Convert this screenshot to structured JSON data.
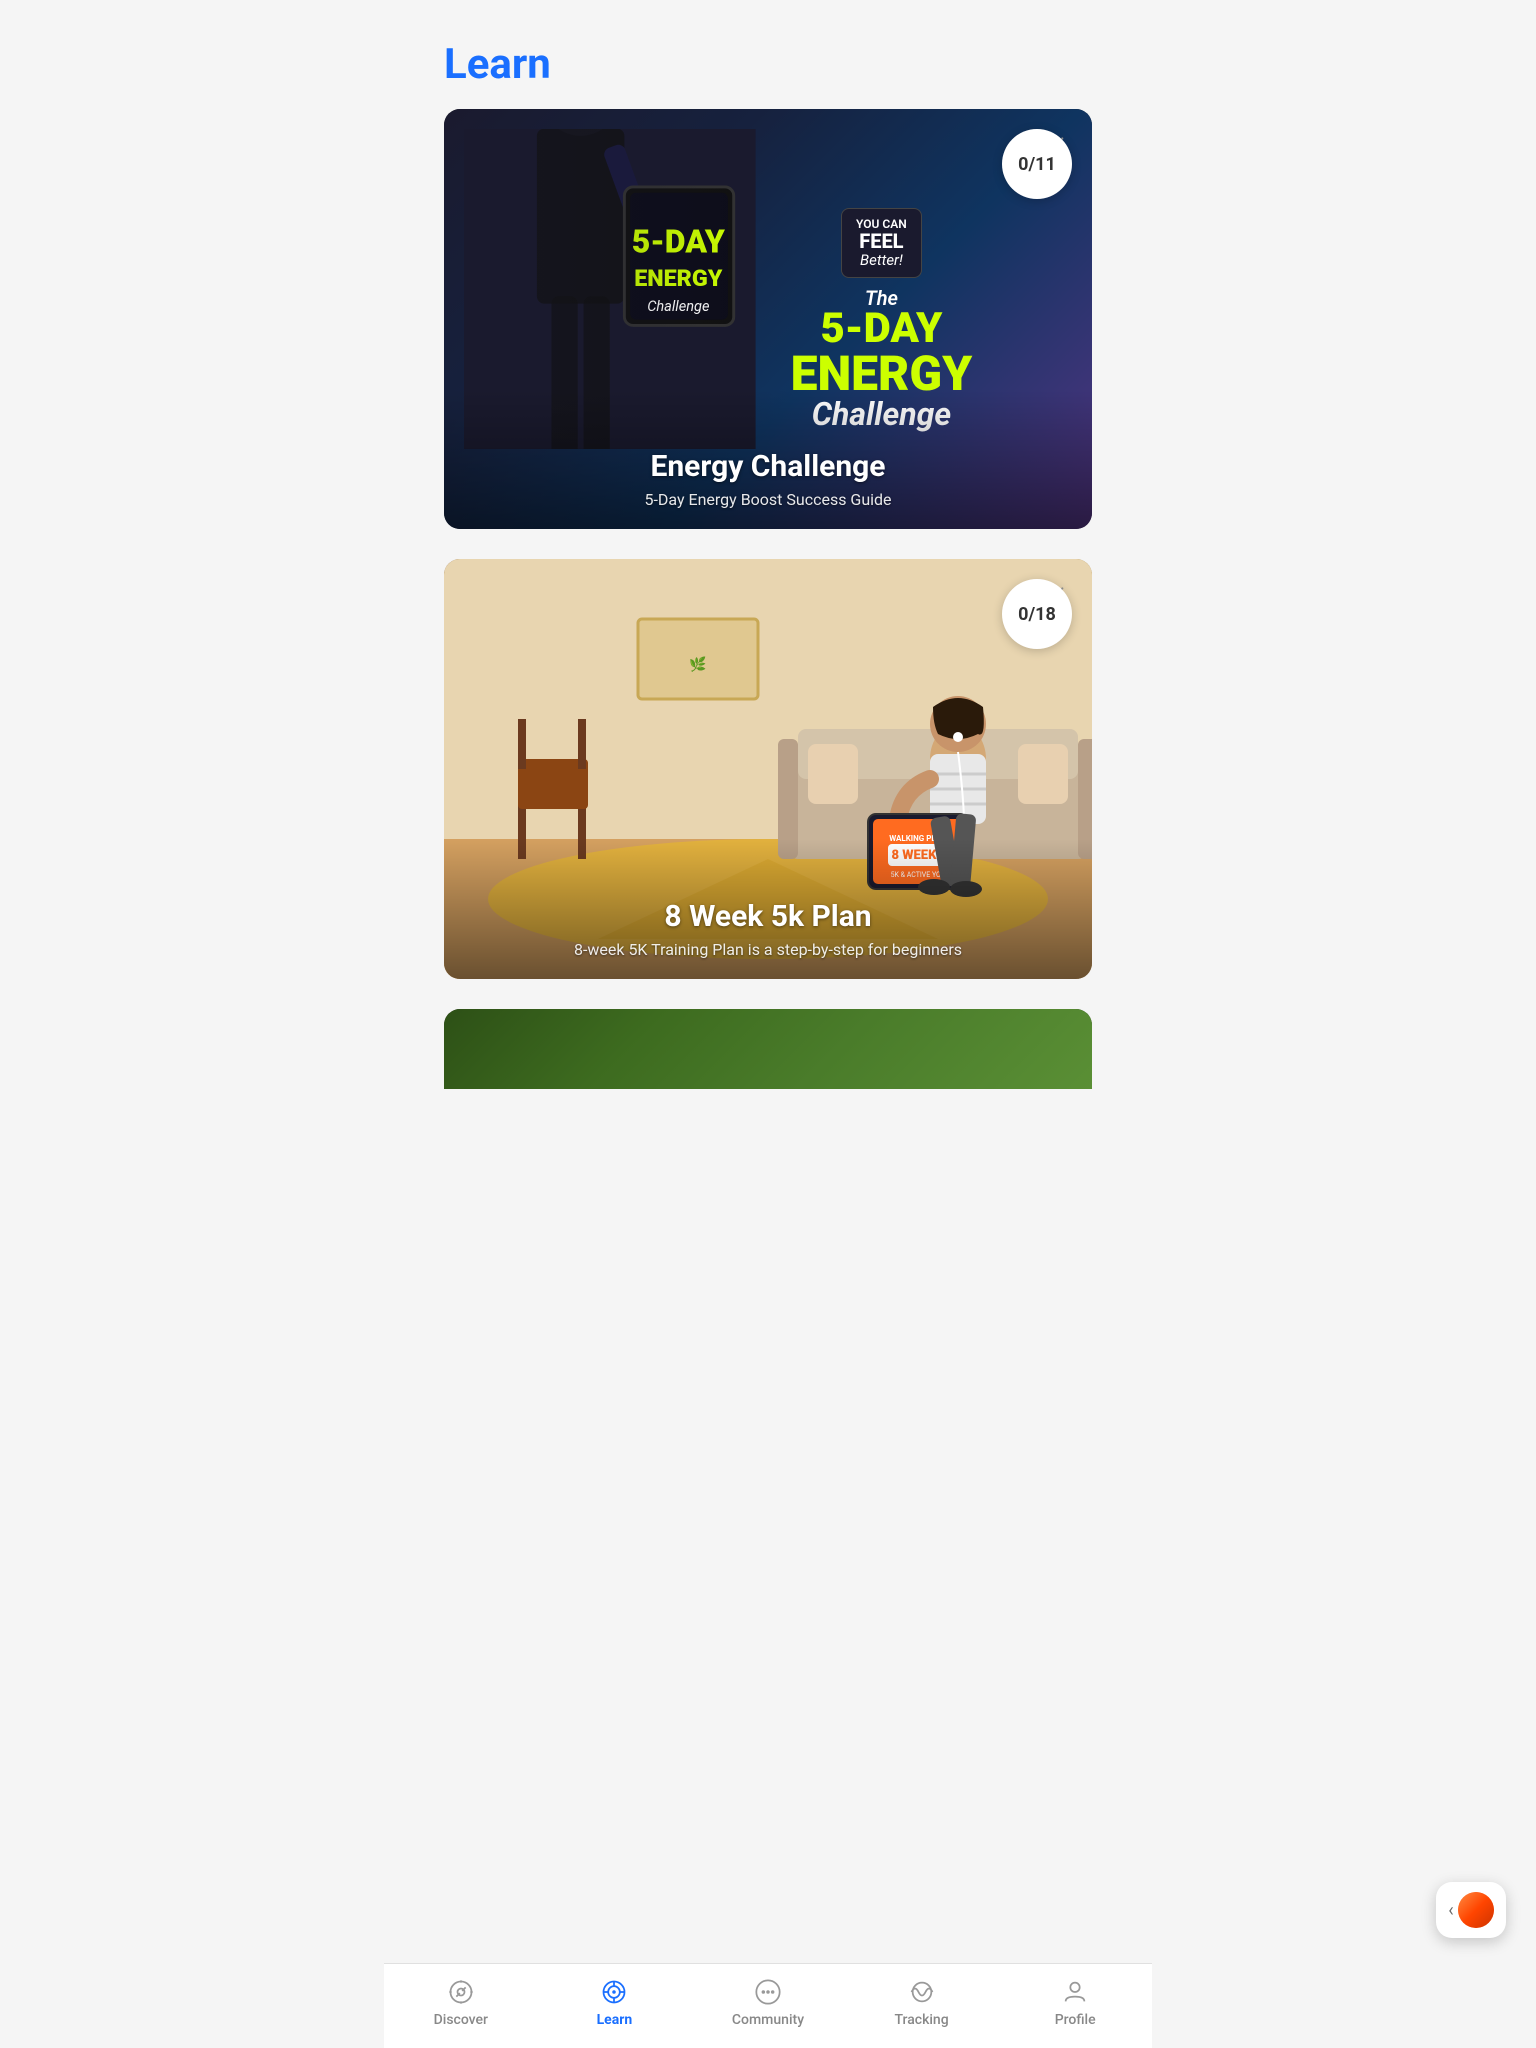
{
  "header": {
    "title": "Learn"
  },
  "cards": [
    {
      "id": "energy-challenge",
      "title": "Energy Challenge",
      "subtitle": "5-Day Energy Boost Success Guide",
      "progress": "0/11",
      "type": "energy"
    },
    {
      "id": "8-week-5k",
      "title": "8 Week 5k Plan",
      "subtitle": "8-week 5K Training Plan is a step-by-step for  beginners",
      "progress": "0/18",
      "type": "walking"
    }
  ],
  "nav": {
    "items": [
      {
        "id": "discover",
        "label": "Discover",
        "active": false
      },
      {
        "id": "learn",
        "label": "Learn",
        "active": true
      },
      {
        "id": "community",
        "label": "Community",
        "active": false
      },
      {
        "id": "tracking",
        "label": "Tracking",
        "active": false
      },
      {
        "id": "profile",
        "label": "Profile",
        "active": false
      }
    ]
  },
  "floating": {
    "chevron": "‹"
  }
}
